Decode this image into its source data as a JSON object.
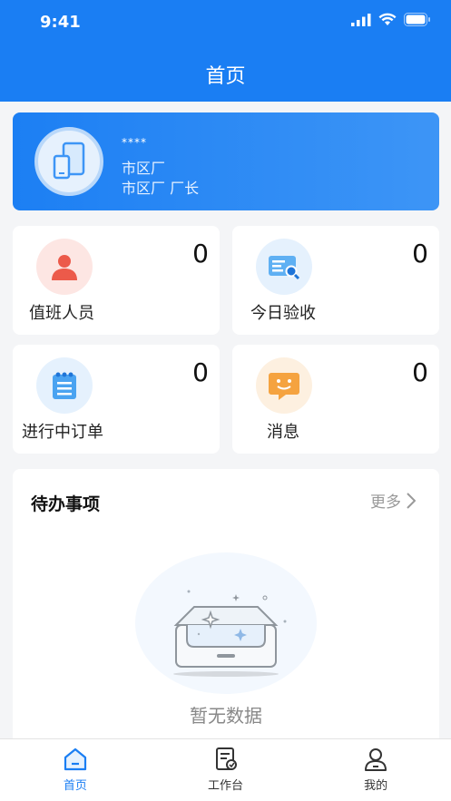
{
  "status_bar": {
    "time": "9:41"
  },
  "header": {
    "title": "首页"
  },
  "user": {
    "masked_name": "****",
    "org": "市区厂",
    "role": "市区厂 厂长"
  },
  "stats": [
    {
      "label": "值班人员",
      "count": "0",
      "icon": "person-icon",
      "color": "#f06a5a"
    },
    {
      "label": "今日验收",
      "count": "0",
      "icon": "inspection-icon",
      "color": "#3a9bf0"
    },
    {
      "label": "进行中订单",
      "count": "0",
      "icon": "order-list-icon",
      "color": "#3a9bf0"
    },
    {
      "label": "消息",
      "count": "0",
      "icon": "message-icon",
      "color": "#f5a340"
    }
  ],
  "todo": {
    "title": "待办事项",
    "more_label": "更多",
    "empty_text": "暂无数据"
  },
  "tabbar": {
    "items": [
      {
        "label": "首页",
        "icon": "home-icon",
        "active": true
      },
      {
        "label": "工作台",
        "icon": "workbench-icon",
        "active": false
      },
      {
        "label": "我的",
        "icon": "profile-icon",
        "active": false
      }
    ]
  },
  "colors": {
    "brand": "#1a7ef3",
    "background": "#f4f5f7"
  }
}
